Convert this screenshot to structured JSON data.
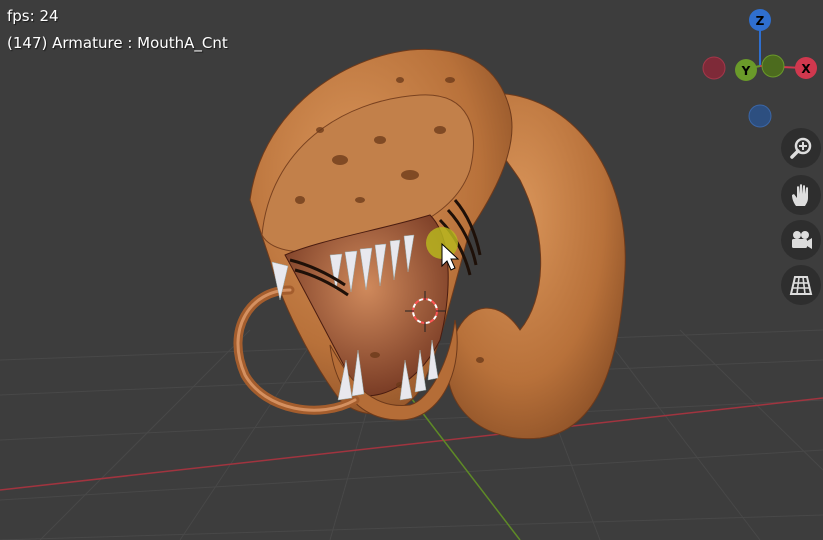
{
  "overlay": {
    "fps_label": "fps:",
    "fps_value": "24",
    "frame": "(147)",
    "object_path": "Armature : MouthA_Cnt"
  },
  "gizmo": {
    "z_label": "Z",
    "y_label": "Y",
    "x_label": "X",
    "colors": {
      "x": "#d0384e",
      "y": "#6a9a2a",
      "z": "#2f6fcf"
    }
  },
  "nav_buttons": [
    {
      "name": "zoom",
      "icon": "zoom-in-icon"
    },
    {
      "name": "pan",
      "icon": "hand-icon"
    },
    {
      "name": "camera",
      "icon": "camera-icon"
    },
    {
      "name": "perspective",
      "icon": "grid-perspective-icon"
    }
  ],
  "colors": {
    "background": "#3d3d3d",
    "grid": "#4a4a4a",
    "axis_x": "#a1343f",
    "axis_y": "#5e8a26",
    "creature": "#c07a3e"
  }
}
